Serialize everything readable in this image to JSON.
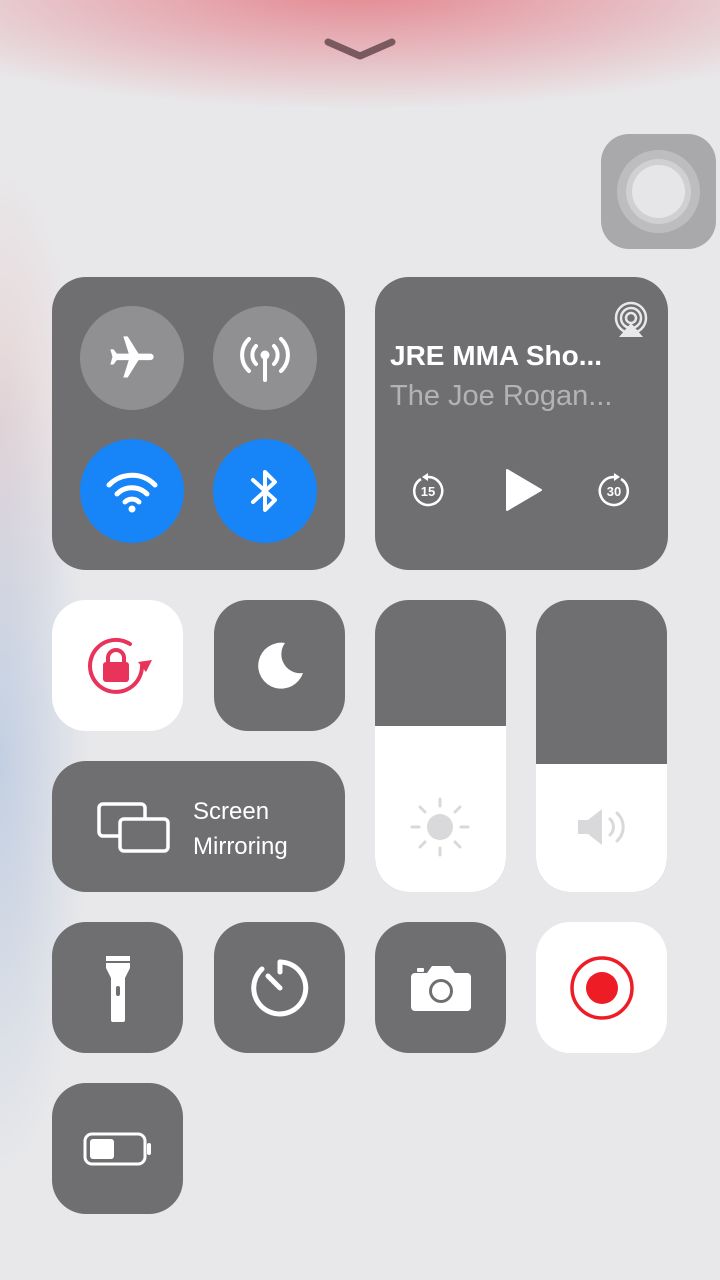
{
  "control_center": {
    "connectivity": {
      "airplane_mode": false,
      "cellular_data": false,
      "wifi": true,
      "bluetooth": true
    },
    "now_playing": {
      "title": "JRE MMA Sho...",
      "subtitle": "The Joe Rogan...",
      "skip_back_seconds": "15",
      "skip_forward_seconds": "30"
    },
    "screen_mirroring": {
      "line1": "Screen",
      "line2": "Mirroring"
    },
    "orientation_lock": true,
    "do_not_disturb": false,
    "brightness_level": 0.57,
    "volume_level": 0.44,
    "screen_recording": true,
    "colors": {
      "accent_blue": "#1784f7",
      "lock_red": "#e8335a",
      "record_red": "#ee1c25",
      "tile_gray": "#6f6f72"
    },
    "icons": [
      "chevron-down-icon",
      "assistive-touch-icon",
      "airplane-icon",
      "cellular-icon",
      "wifi-icon",
      "bluetooth-icon",
      "airplay-icon",
      "skip-back-icon",
      "play-icon",
      "skip-forward-icon",
      "orientation-lock-icon",
      "moon-icon",
      "screen-mirroring-icon",
      "brightness-icon",
      "volume-icon",
      "flashlight-icon",
      "timer-icon",
      "camera-icon",
      "record-icon",
      "battery-icon"
    ]
  }
}
